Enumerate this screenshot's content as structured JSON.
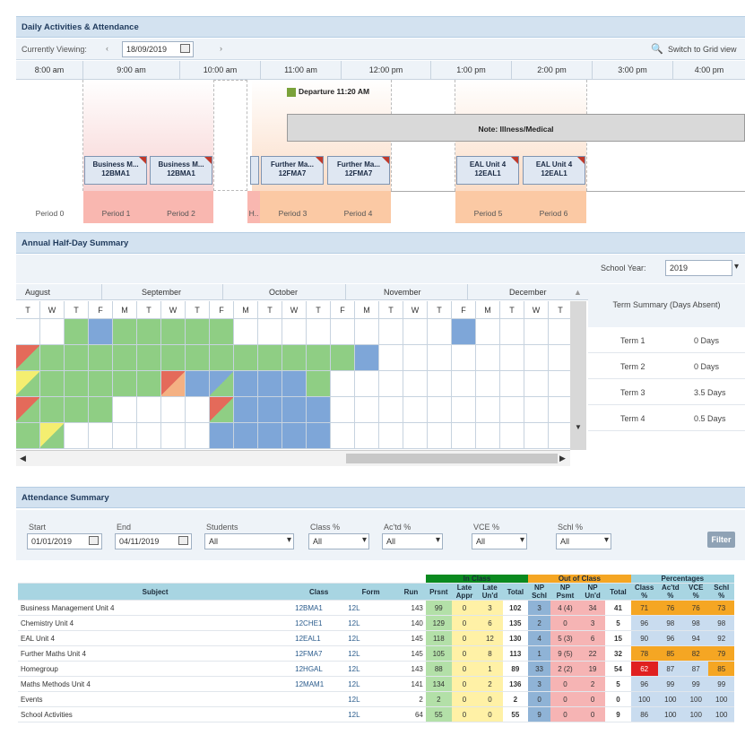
{
  "daily": {
    "title": "Daily Activities & Attendance",
    "currently_viewing_label": "Currently Viewing:",
    "date_value": "18/09/2019",
    "switch_label": "Switch to Grid view",
    "times": [
      "8:00 am",
      "9:00 am",
      "10:00 am",
      "11:00 am",
      "12:00 pm",
      "1:00 pm",
      "2:00 pm",
      "3:00 pm",
      "4:00 pm"
    ],
    "departure": "Departure 11:20 AM",
    "note": "Note: Illness/Medical",
    "lessons": [
      {
        "name": "Business M...",
        "code": "12BMA1"
      },
      {
        "name": "Business M...",
        "code": "12BMA1"
      },
      {
        "name": "Further Ma...",
        "code": "12FMA7"
      },
      {
        "name": "Further Ma...",
        "code": "12FMA7"
      },
      {
        "name": "EAL Unit 4",
        "code": "12EAL1"
      },
      {
        "name": "EAL Unit 4",
        "code": "12EAL1"
      }
    ],
    "periods": [
      "Period 0",
      "Period 1",
      "Period 2",
      "H..",
      "Period 3",
      "Period 4",
      "Period 5",
      "Period 6"
    ]
  },
  "annual": {
    "title": "Annual Half-Day Summary",
    "school_year_label": "School Year:",
    "school_year_value": "2019",
    "months": [
      "August",
      "September",
      "October",
      "November",
      "December"
    ],
    "days": [
      "T",
      "W",
      "T",
      "F",
      "M",
      "T",
      "W",
      "T",
      "F",
      "M",
      "T",
      "W",
      "T",
      "F",
      "M",
      "T",
      "W",
      "T",
      "F",
      "M",
      "T",
      "W",
      "T"
    ],
    "term_summary_title": "Term Summary (Days Absent)",
    "terms": [
      {
        "term": "Term 1",
        "days": "0 Days"
      },
      {
        "term": "Term 2",
        "days": "0 Days"
      },
      {
        "term": "Term 3",
        "days": "3.5 Days"
      },
      {
        "term": "Term 4",
        "days": "0.5 Days"
      }
    ],
    "colors": {
      "present": "#8fce84",
      "absent": "#7ea6d8",
      "late": "#f4ee70",
      "unapproved": "#e46a5a"
    }
  },
  "summary": {
    "title": "Attendance Summary",
    "filters": {
      "start_label": "Start",
      "start_value": "01/01/2019",
      "end_label": "End",
      "end_value": "04/11/2019",
      "students_label": "Students",
      "students_value": "All",
      "class_label": "Class %",
      "class_value": "All",
      "actd_label": "Ac'td %",
      "actd_value": "All",
      "vce_label": "VCE %",
      "vce_value": "All",
      "schl_label": "Schl %",
      "schl_value": "All",
      "filter_button": "Filter"
    },
    "groups": {
      "in": "In Class",
      "out": "Out of Class",
      "pct": "Percentages"
    },
    "headers": [
      "Subject",
      "Class",
      "Form",
      "Run",
      "Prsnt",
      "Late Appr",
      "Late Un'd",
      "Total",
      "NP Schl",
      "NP Psmt",
      "NP Un'd",
      "Total",
      "Class %",
      "Ac'td %",
      "VCE %",
      "Schl %"
    ],
    "rows": [
      [
        "Business Management Unit 4",
        "12BMA1",
        "12L",
        "143",
        "99",
        "0",
        "3",
        "102",
        "3",
        "4 (4)",
        "34",
        "41",
        "71",
        "76",
        "76",
        "73"
      ],
      [
        "Chemistry Unit 4",
        "12CHE1",
        "12L",
        "140",
        "129",
        "0",
        "6",
        "135",
        "2",
        "0",
        "3",
        "5",
        "96",
        "98",
        "98",
        "98"
      ],
      [
        "EAL Unit 4",
        "12EAL1",
        "12L",
        "145",
        "118",
        "0",
        "12",
        "130",
        "4",
        "5 (3)",
        "6",
        "15",
        "90",
        "96",
        "94",
        "92"
      ],
      [
        "Further Maths Unit 4",
        "12FMA7",
        "12L",
        "145",
        "105",
        "0",
        "8",
        "113",
        "1",
        "9 (5)",
        "22",
        "32",
        "78",
        "85",
        "82",
        "79"
      ],
      [
        "Homegroup",
        "12HGAL",
        "12L",
        "143",
        "88",
        "0",
        "1",
        "89",
        "33",
        "2 (2)",
        "19",
        "54",
        "62",
        "87",
        "87",
        "85"
      ],
      [
        "Maths Methods Unit 4",
        "12MAM1",
        "12L",
        "141",
        "134",
        "0",
        "2",
        "136",
        "3",
        "0",
        "2",
        "5",
        "96",
        "99",
        "99",
        "99"
      ],
      [
        "Events",
        "",
        "12L",
        "2",
        "2",
        "0",
        "0",
        "2",
        "0",
        "0",
        "0",
        "0",
        "100",
        "100",
        "100",
        "100"
      ],
      [
        "School Activities",
        "",
        "12L",
        "64",
        "55",
        "0",
        "0",
        "55",
        "9",
        "0",
        "0",
        "9",
        "86",
        "100",
        "100",
        "100"
      ]
    ]
  }
}
